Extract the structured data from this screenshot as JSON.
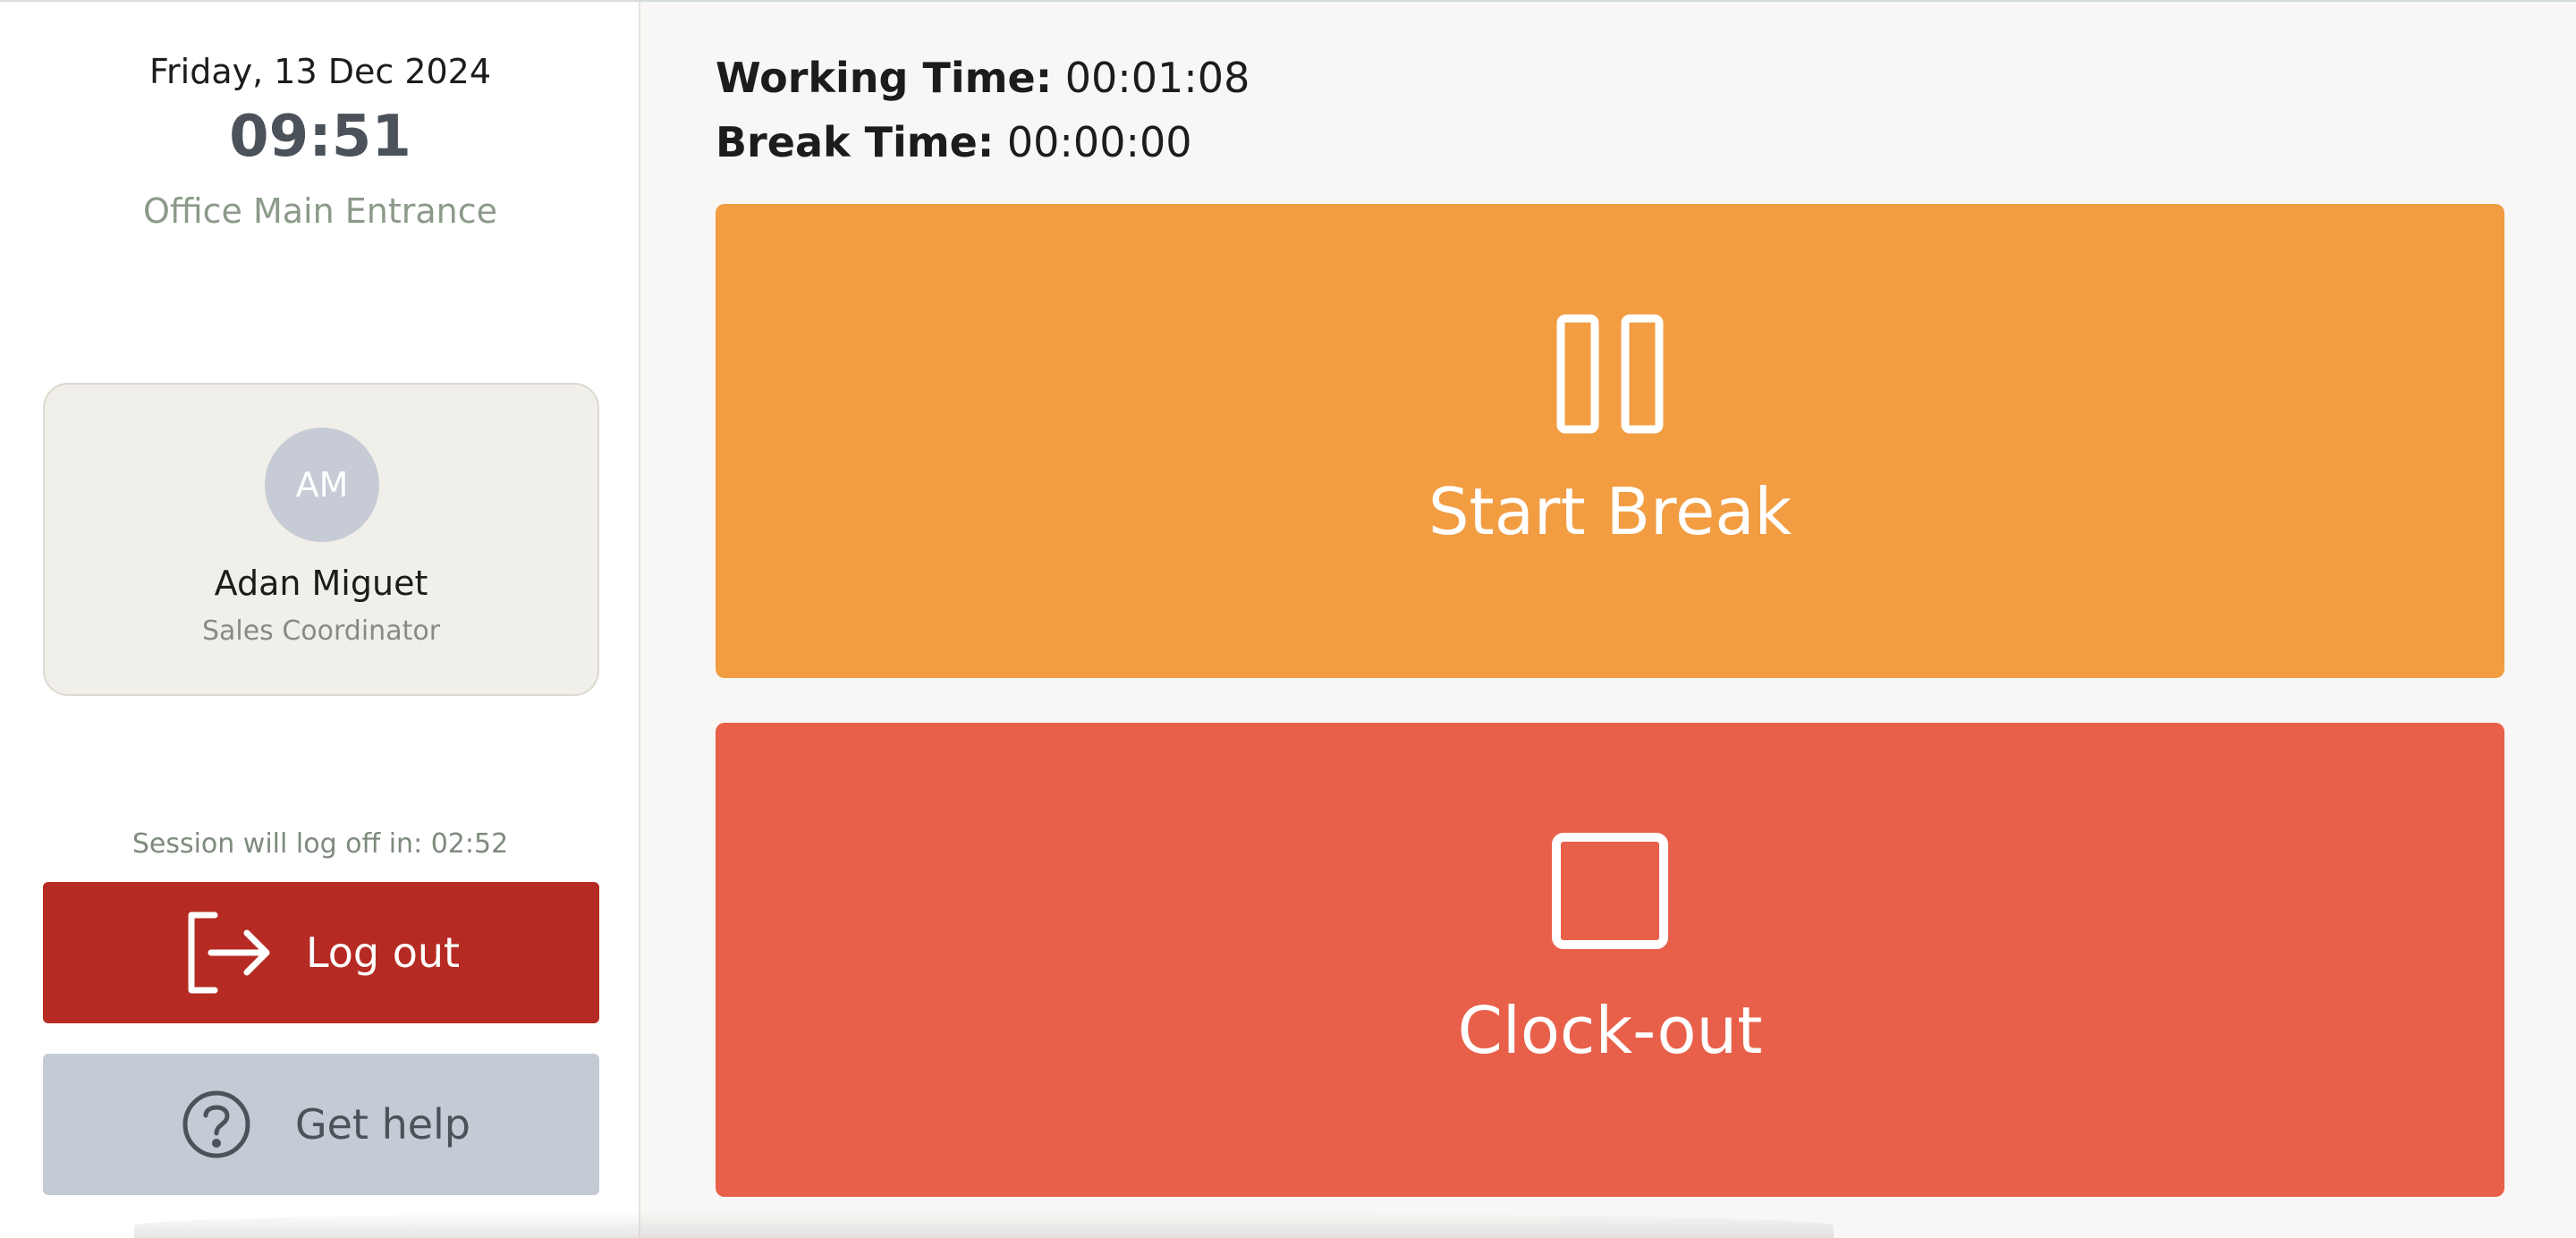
{
  "sidebar": {
    "date": "Friday, 13 Dec 2024",
    "time": "09:51",
    "location": "Office Main Entrance",
    "user": {
      "initials": "AM",
      "name": "Adan Miguet",
      "role": "Sales Coordinator"
    },
    "session_note": "Session will log off in: 02:52",
    "logout_label": "Log out",
    "help_label": "Get help"
  },
  "main": {
    "working_label": "Working Time:",
    "working_value": "00:01:08",
    "break_label": "Break Time:",
    "break_value": "00:00:00",
    "start_break_label": "Start Break",
    "clockout_label": "Clock-out"
  },
  "icons": {
    "logout": "logout-arrow-icon",
    "help": "question-circle-icon",
    "break": "pause-icon",
    "clockout": "stop-square-icon"
  },
  "colors": {
    "break_button": "#f29d42",
    "clockout_button": "#e8604a",
    "logout_button": "#b52a22",
    "help_button": "#c5cbd5",
    "avatar": "#c6cbd5"
  }
}
